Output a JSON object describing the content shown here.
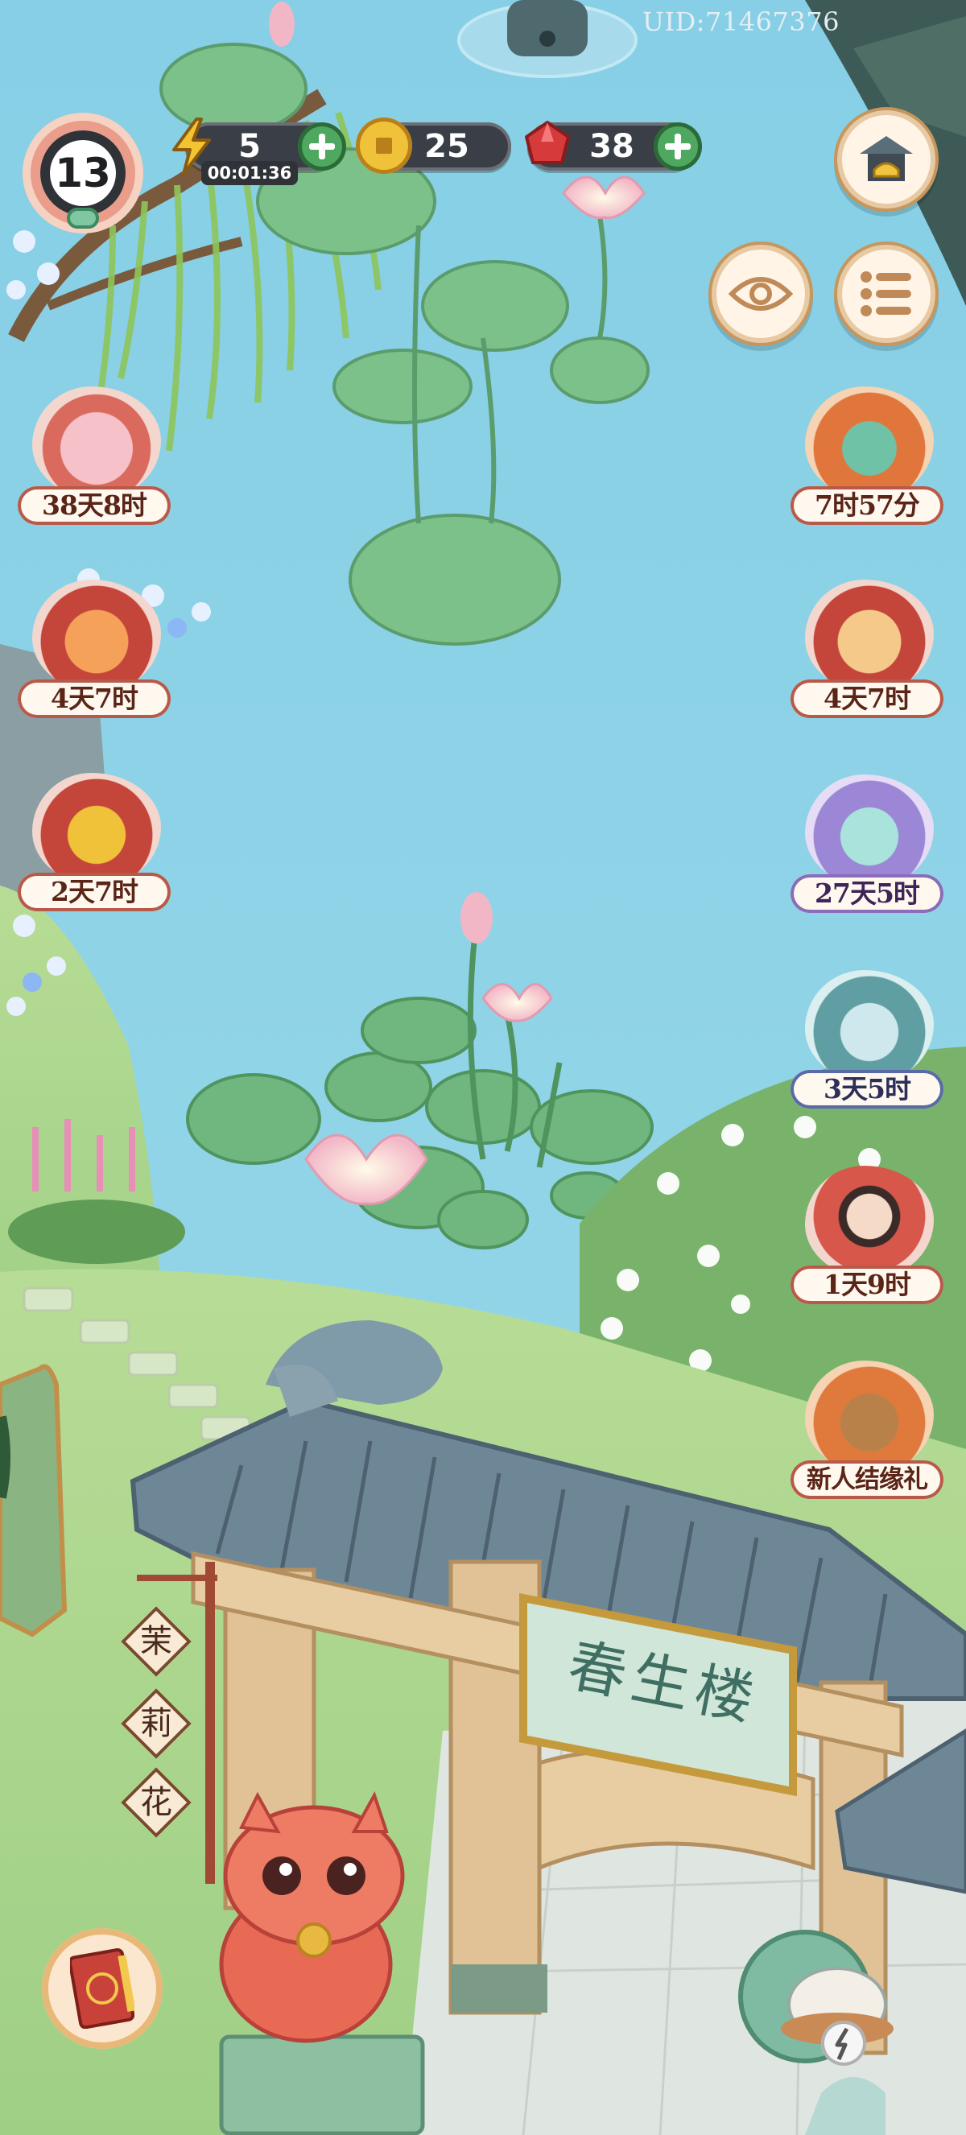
{
  "uid": "UID:71467376",
  "hud": {
    "level": "13",
    "energy": {
      "value": "5",
      "timer": "00:01:36"
    },
    "coins": {
      "value": "25"
    },
    "gems": {
      "value": "38"
    }
  },
  "left_events": [
    {
      "name": "event-book-festival",
      "time": "38天8时"
    },
    {
      "name": "event-fortune-cat",
      "time": "4天7时"
    },
    {
      "name": "event-golden-coin",
      "time": "2天7时"
    }
  ],
  "right_events": [
    {
      "name": "event-jade-ruyi",
      "time": "7时57分"
    },
    {
      "name": "event-fan-cat",
      "time": "4天7时"
    },
    {
      "name": "event-cloud-spirit",
      "time": "27天5时"
    },
    {
      "name": "event-gift-box",
      "time": "3天5时"
    },
    {
      "name": "event-tea-girl",
      "time": "1天9时"
    },
    {
      "name": "event-newbie-gift",
      "time": "新人结缘礼"
    }
  ],
  "gate": {
    "plaque": "春生楼"
  },
  "shop_sign": [
    "茉",
    "莉",
    "花"
  ],
  "colors": {
    "water": "#8fd3e8",
    "grass": "#a8d48a",
    "roof": "#6f8a9a",
    "wood": "#d9b98a",
    "accent_red": "#c9423a"
  }
}
